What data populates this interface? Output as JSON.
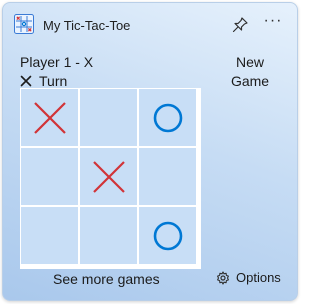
{
  "header": {
    "app_icon": "tic-tac-toe-icon",
    "title": "My Tic-Tac-Toe",
    "pin_icon": "pin-icon",
    "more_label": "···"
  },
  "status": {
    "player": "Player 1 - X",
    "turn_mark": "X",
    "turn_text": "Turn"
  },
  "new_game": {
    "line1": "New",
    "line2": "Game"
  },
  "board": {
    "cells": [
      "X",
      "",
      "O",
      "",
      "X",
      "",
      "",
      "",
      "O"
    ]
  },
  "footer": {
    "more_games": "See more games",
    "options_icon": "gear-icon",
    "options_label": "Options"
  },
  "colors": {
    "x_mark": "#d13438",
    "o_mark": "#0078d4",
    "cell_bg": "#c8def6",
    "grid_line": "#ffffff"
  }
}
